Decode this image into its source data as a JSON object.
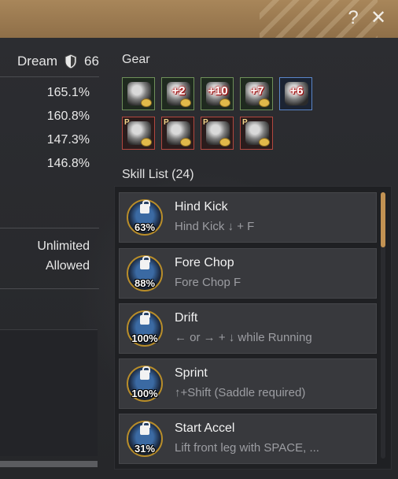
{
  "window": {
    "help_icon": "?",
    "close_icon": "✕"
  },
  "stats": {
    "dream_label": "Dream",
    "dream_value": "66",
    "percentages": [
      "165.1%",
      "160.8%",
      "147.3%",
      "146.8%"
    ],
    "misc": [
      "Unlimited",
      "Allowed"
    ]
  },
  "gear": {
    "label": "Gear",
    "slots": [
      {
        "enhance": "",
        "rarity": "green",
        "icon": "helmet-icon"
      },
      {
        "enhance": "+2",
        "rarity": "green",
        "icon": "saddle-icon"
      },
      {
        "enhance": "+10",
        "rarity": "green",
        "icon": "stirrups-icon"
      },
      {
        "enhance": "+7",
        "rarity": "green",
        "icon": "horseshoe-icon"
      },
      {
        "enhance": "+6",
        "rarity": "blue",
        "icon": "horseshoe-icon"
      },
      {
        "enhance": "",
        "rarity": "red",
        "icon": "barding-icon"
      },
      {
        "enhance": "",
        "rarity": "red",
        "icon": "saddle-icon"
      },
      {
        "enhance": "",
        "rarity": "red",
        "icon": "stirrups-icon"
      },
      {
        "enhance": "",
        "rarity": "red",
        "icon": "horse-helmet-icon"
      }
    ]
  },
  "skills": {
    "label": "Skill List (24)",
    "items": [
      {
        "name": "Hind Kick",
        "command": "Hind Kick ↓ + F",
        "progress": "63%"
      },
      {
        "name": "Fore Chop",
        "command": "Fore Chop F",
        "progress": "88%"
      },
      {
        "name": "Drift",
        "command": "← or → + ↓ while Running",
        "progress": "100%"
      },
      {
        "name": "Sprint",
        "command": "↑+Shift (Saddle required)",
        "progress": "100%"
      },
      {
        "name": "Start Accel",
        "command": "Lift front leg with SPACE, ...",
        "progress": "31%"
      }
    ]
  },
  "colors": {
    "title_bar": "#a8865a",
    "scroll_thumb": "#c29253"
  }
}
